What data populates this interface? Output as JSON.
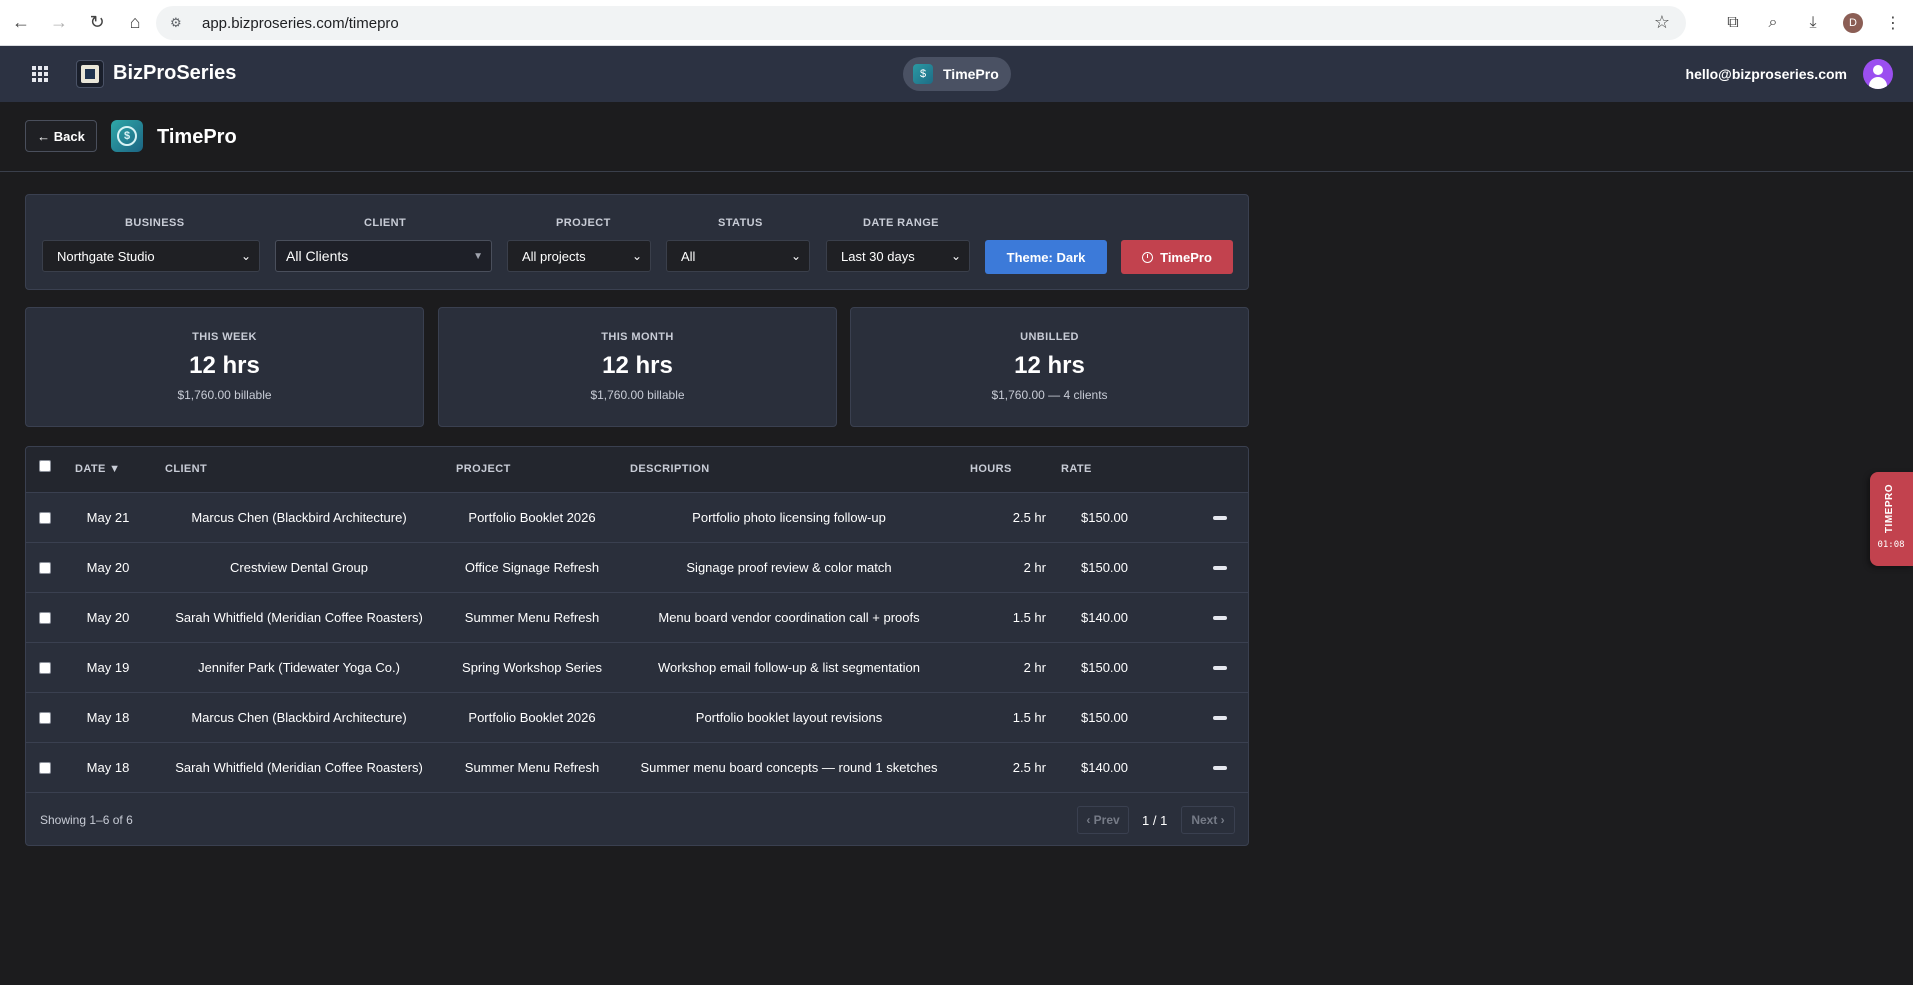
{
  "browser": {
    "url": "app.bizproseries.com/timepro",
    "profile_initial": "D"
  },
  "header": {
    "brand": "BizProSeries",
    "app_pill": "TimePro",
    "user_email": "hello@bizproseries.com"
  },
  "page": {
    "back_label": "← Back",
    "title": "TimePro",
    "icon_glyph": "$"
  },
  "filters": {
    "business": {
      "label": "BUSINESS",
      "value": "Northgate Studio"
    },
    "client": {
      "label": "CLIENT",
      "value": "All Clients"
    },
    "project": {
      "label": "PROJECT",
      "value": "All projects"
    },
    "status": {
      "label": "STATUS",
      "value": "All"
    },
    "date_range": {
      "label": "DATE RANGE",
      "value": "Last 30 days"
    },
    "theme_button": "Theme: Dark",
    "timepro_button": "TimePro"
  },
  "stats": {
    "week": {
      "label": "THIS WEEK",
      "value": "12 hrs",
      "sub": "$1,760.00 billable"
    },
    "month": {
      "label": "THIS MONTH",
      "value": "12 hrs",
      "sub": "$1,760.00 billable"
    },
    "unbilled": {
      "label": "UNBILLED",
      "value": "12 hrs",
      "sub": "$1,760.00 — 4 clients"
    }
  },
  "table": {
    "headers": {
      "date": "DATE ▼",
      "client": "CLIENT",
      "project": "PROJECT",
      "description": "DESCRIPTION",
      "hours": "HOURS",
      "rate": "RATE"
    },
    "rows": [
      {
        "date": "May 21",
        "client": "Marcus Chen (Blackbird Architecture)",
        "project": "Portfolio Booklet 2026",
        "description": "Portfolio photo licensing follow-up",
        "hours": "2.5 hr",
        "rate": "$150.00"
      },
      {
        "date": "May 20",
        "client": "Crestview Dental Group",
        "project": "Office Signage Refresh",
        "description": "Signage proof review & color match",
        "hours": "2 hr",
        "rate": "$150.00"
      },
      {
        "date": "May 20",
        "client": "Sarah Whitfield (Meridian Coffee Roasters)",
        "project": "Summer Menu Refresh",
        "description": "Menu board vendor coordination call + proofs",
        "hours": "1.5 hr",
        "rate": "$140.00"
      },
      {
        "date": "May 19",
        "client": "Jennifer Park (Tidewater Yoga Co.)",
        "project": "Spring Workshop Series",
        "description": "Workshop email follow-up & list segmentation",
        "hours": "2 hr",
        "rate": "$150.00"
      },
      {
        "date": "May 18",
        "client": "Marcus Chen (Blackbird Architecture)",
        "project": "Portfolio Booklet 2026",
        "description": "Portfolio booklet layout revisions",
        "hours": "1.5 hr",
        "rate": "$150.00"
      },
      {
        "date": "May 18",
        "client": "Sarah Whitfield (Meridian Coffee Roasters)",
        "project": "Summer Menu Refresh",
        "description": "Summer menu board concepts — round 1 sketches",
        "hours": "2.5 hr",
        "rate": "$140.00"
      }
    ],
    "showing": "Showing 1–6 of 6",
    "prev": "‹ Prev",
    "page": "1 / 1",
    "next": "Next ›"
  },
  "timer_tab": {
    "label": "TIMEPRO",
    "time": "01:08"
  },
  "colors": {
    "header_bg": "#2c3242",
    "card_bg": "#2a2f3b",
    "theme_button": "#3c7ad9",
    "timepro_red": "#c2424e"
  }
}
